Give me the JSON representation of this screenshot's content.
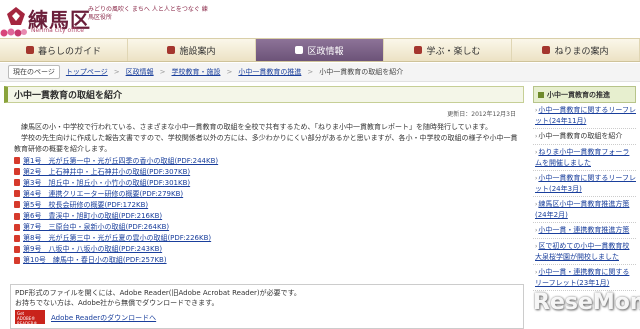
{
  "header": {
    "site_title": "練馬区",
    "site_subtitle": "Nerima city office",
    "tagline": "みどりの風吹く まちへ 人と人とをつなぐ 練馬区役所"
  },
  "nav": {
    "items": [
      {
        "label": "暮らしのガイド",
        "active": false
      },
      {
        "label": "施設案内",
        "active": false
      },
      {
        "label": "区政情報",
        "active": true
      },
      {
        "label": "学ぶ・楽しむ",
        "active": false
      },
      {
        "label": "ねりまの案内",
        "active": false
      }
    ]
  },
  "breadcrumb": {
    "here_label": "現在のページ",
    "items": [
      "トップページ",
      "区政情報",
      "学校教育・施設",
      "小中一貫教育の推進"
    ],
    "current": "小中一貫教育の取組を紹介"
  },
  "main": {
    "title": "小中一貫教育の取組を紹介",
    "updated": "更新日：2012年12月3日",
    "intro": [
      "練馬区の小・中学校で行われている、さまざまな小中一貫教育の取組を全校で共有するため、「ねりま小中一貫教育レポート」を随時発行しています。",
      "学校の先生向けに作成した報告文書ですので、学校関係者以外の方には、多少わかりにくい部分があるかと思いますが、各小・中学校の取組の様子や小中一貫教育研修の概要を紹介します。"
    ],
    "links": [
      "第1号　光が丘第一中・光が丘四季の香小の取組(PDF:244KB)",
      "第2号　上石神井中・上石神井小の取組(PDF:307KB)",
      "第3号　旭丘中・旭丘小・小竹小の取組(PDF:301KB)",
      "第4号　連携クリエーター研修の概要(PDF:279KB)",
      "第5号　校長会研修の概要(PDF:172KB)",
      "第6号　豊渓中・旭町小の取組(PDF:216KB)",
      "第7号　三原台中・泉新小の取組(PDF:264KB)",
      "第8号　光が丘第三中・光が丘夏の雲小の取組(PDF:226KB)",
      "第9号　八坂中・八坂小の取組(PDF:243KB)",
      "第10号　練馬中・春日小の取組(PDF:257KB)"
    ],
    "pdf_note_1": "PDF形式のファイルを開くには、Adobe Reader(旧Adobe Acrobat Reader)が必要です。",
    "pdf_note_2": "お持ちでない方は、Adobe社から無償でダウンロードできます。",
    "reader_badge": "Get ADOBE® READER®",
    "reader_link": "Adobe Readerのダウンロードへ"
  },
  "sidebar": {
    "heading": "小中一貫教育の推進",
    "items": [
      {
        "text": "小中一貫教育に関するリーフレット(24年11月)",
        "link": true
      },
      {
        "text": "小中一貫教育の取組を紹介",
        "link": false
      },
      {
        "text": "ねりま小中一貫教育フォーラムを開催しました",
        "link": true
      },
      {
        "text": "小中一貫教育に関するリーフレット(24年3月)",
        "link": true
      },
      {
        "text": "練馬区小中一貫教育推進方策(24年2月)",
        "link": true
      },
      {
        "text": "小中一貫・連携教育推進方策",
        "link": true
      },
      {
        "text": "区で初めての小中一貫教育校 大泉桜学園が開校しました",
        "link": true
      },
      {
        "text": "小中一貫・連携教育に関するリーフレット(23年1月)",
        "link": true
      }
    ]
  },
  "watermark": "ReseMom",
  "colors": {
    "accent_purple": "#6c5378",
    "link_blue": "#1a3f9c",
    "title_green": "#8aa33c",
    "brand_maroon": "#6b1f3a"
  }
}
